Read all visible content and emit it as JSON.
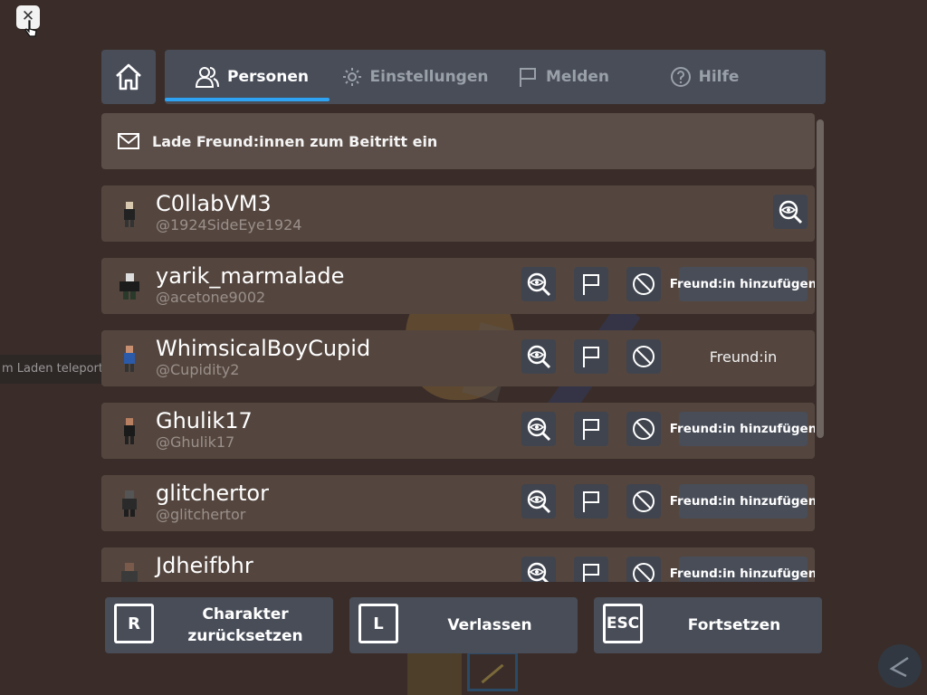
{
  "close_button": {
    "glyph": "✕"
  },
  "teleport_tooltip": {
    "text": "m Laden teleportieren"
  },
  "header": {
    "tabs": [
      {
        "label": "Personen",
        "icon": "people-icon",
        "active": true
      },
      {
        "label": "Einstellungen",
        "icon": "gear-icon",
        "active": false
      },
      {
        "label": "Melden",
        "icon": "flag-icon",
        "active": false
      },
      {
        "label": "Hilfe",
        "icon": "help-icon",
        "active": false
      }
    ],
    "accent_color": "#2ea2f3"
  },
  "invite": {
    "label": "Lade Freund:innen zum Beitritt ein"
  },
  "players": [
    {
      "name": "C0llabVM3",
      "username": "@1924SideEye1924",
      "actions": [
        "inspect"
      ],
      "friend_label": ""
    },
    {
      "name": "yarik_marmalade",
      "username": "@acetone9002",
      "actions": [
        "inspect",
        "report",
        "block"
      ],
      "friend_label": "Freund:in hinzufügen"
    },
    {
      "name": "WhimsicalBoyCupid",
      "username": "@Cupidity2",
      "actions": [
        "inspect",
        "report",
        "block"
      ],
      "friend_label": "Freund:in"
    },
    {
      "name": "Ghulik17",
      "username": "@Ghulik17",
      "actions": [
        "inspect",
        "report",
        "block"
      ],
      "friend_label": "Freund:in hinzufügen"
    },
    {
      "name": "glitchertor",
      "username": "@glitchertor",
      "actions": [
        "inspect",
        "report",
        "block"
      ],
      "friend_label": "Freund:in hinzufügen"
    },
    {
      "name": "Jdheifbhr",
      "username": "",
      "actions": [
        "inspect",
        "report",
        "block"
      ],
      "friend_label": "Freund:in hinzufügen"
    }
  ],
  "bottom": {
    "reset": {
      "key": "R",
      "label": "Charakter zurücksetzen"
    },
    "leave": {
      "key": "L",
      "label": "Verlassen"
    },
    "resume": {
      "key": "ESC",
      "label": "Fortsetzen"
    }
  }
}
